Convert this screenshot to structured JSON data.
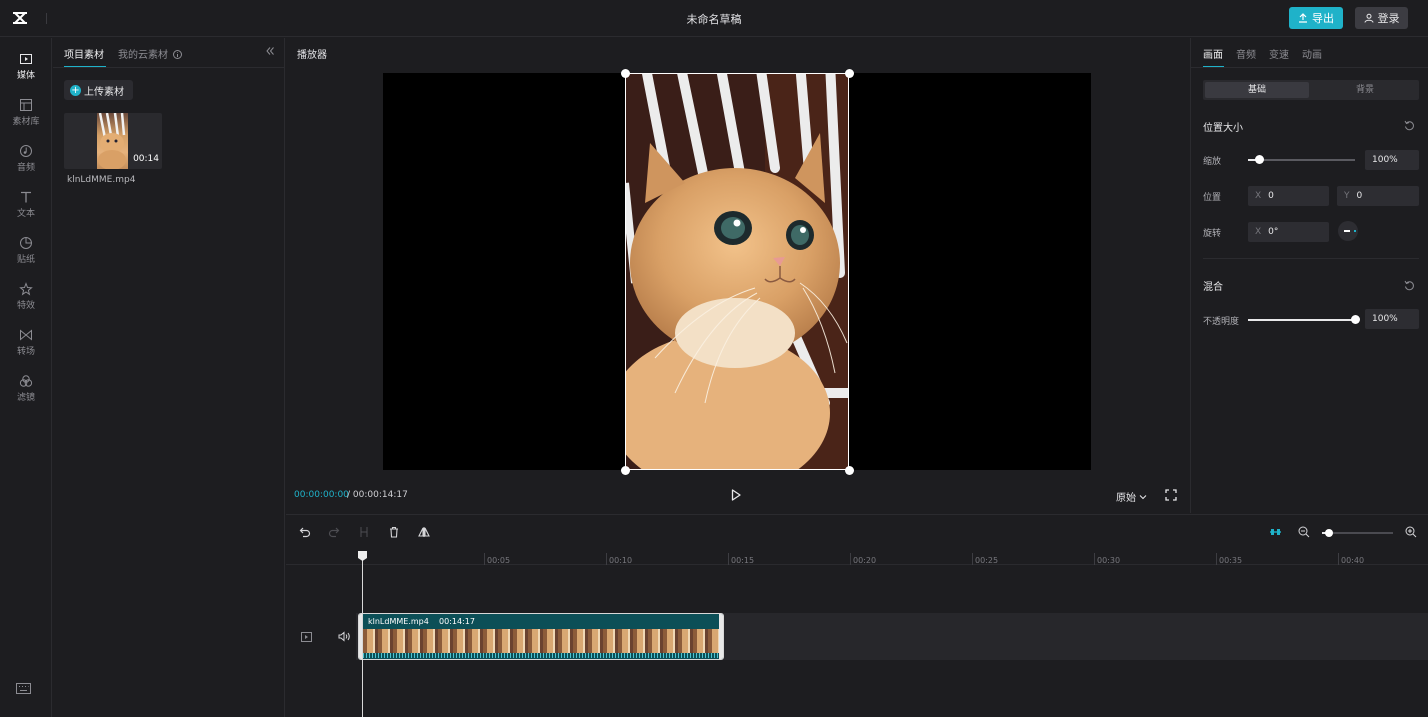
{
  "app": {
    "title": "未命名草稿"
  },
  "topbar": {
    "export_label": "导出",
    "login_label": "登录"
  },
  "nav": [
    {
      "label": "媒体",
      "icon": "media-icon"
    },
    {
      "label": "素材库",
      "icon": "library-icon"
    },
    {
      "label": "音频",
      "icon": "audio-icon"
    },
    {
      "label": "文本",
      "icon": "text-icon"
    },
    {
      "label": "贴纸",
      "icon": "sticker-icon"
    },
    {
      "label": "特效",
      "icon": "effects-icon"
    },
    {
      "label": "转场",
      "icon": "transition-icon"
    },
    {
      "label": "滤镜",
      "icon": "filter-icon"
    }
  ],
  "assets": {
    "tabs": [
      "项目素材",
      "我的云素材"
    ],
    "upload_label": "上传素材",
    "items": [
      {
        "name": "klnLdMME.mp4",
        "duration": "00:14"
      }
    ]
  },
  "player": {
    "title": "播放器",
    "time_current": "00:00:00:00",
    "time_separator": "/",
    "time_total": "00:00:14:17",
    "ratio_label": "原始"
  },
  "props": {
    "tabs": [
      "画面",
      "音频",
      "变速",
      "动画"
    ],
    "segments": [
      "基础",
      "背景"
    ],
    "position_section": "位置大小",
    "scale_label": "缩放",
    "scale_value": "100%",
    "scale_fraction": 0.1,
    "position_label": "位置",
    "pos_x_axis": "X",
    "pos_x": "0",
    "pos_y_axis": "Y",
    "pos_y": "0",
    "rotation_label": "旋转",
    "rot_axis": "X",
    "rotation_value": "0°",
    "blend_section": "混合",
    "opacity_label": "不透明度",
    "opacity_value": "100%",
    "opacity_fraction": 1.0
  },
  "timeline": {
    "ruler": [
      "00:05",
      "00:10",
      "00:15",
      "00:20",
      "00:25",
      "00:30",
      "00:35",
      "00:40"
    ],
    "clip_name": "klnLdMME.mp4",
    "clip_duration": "00:14:17",
    "zoom_fraction": 0.1
  },
  "colors": {
    "accent": "#1fb2c9",
    "clip": "#0c4f57",
    "background": "#1d1d20"
  }
}
